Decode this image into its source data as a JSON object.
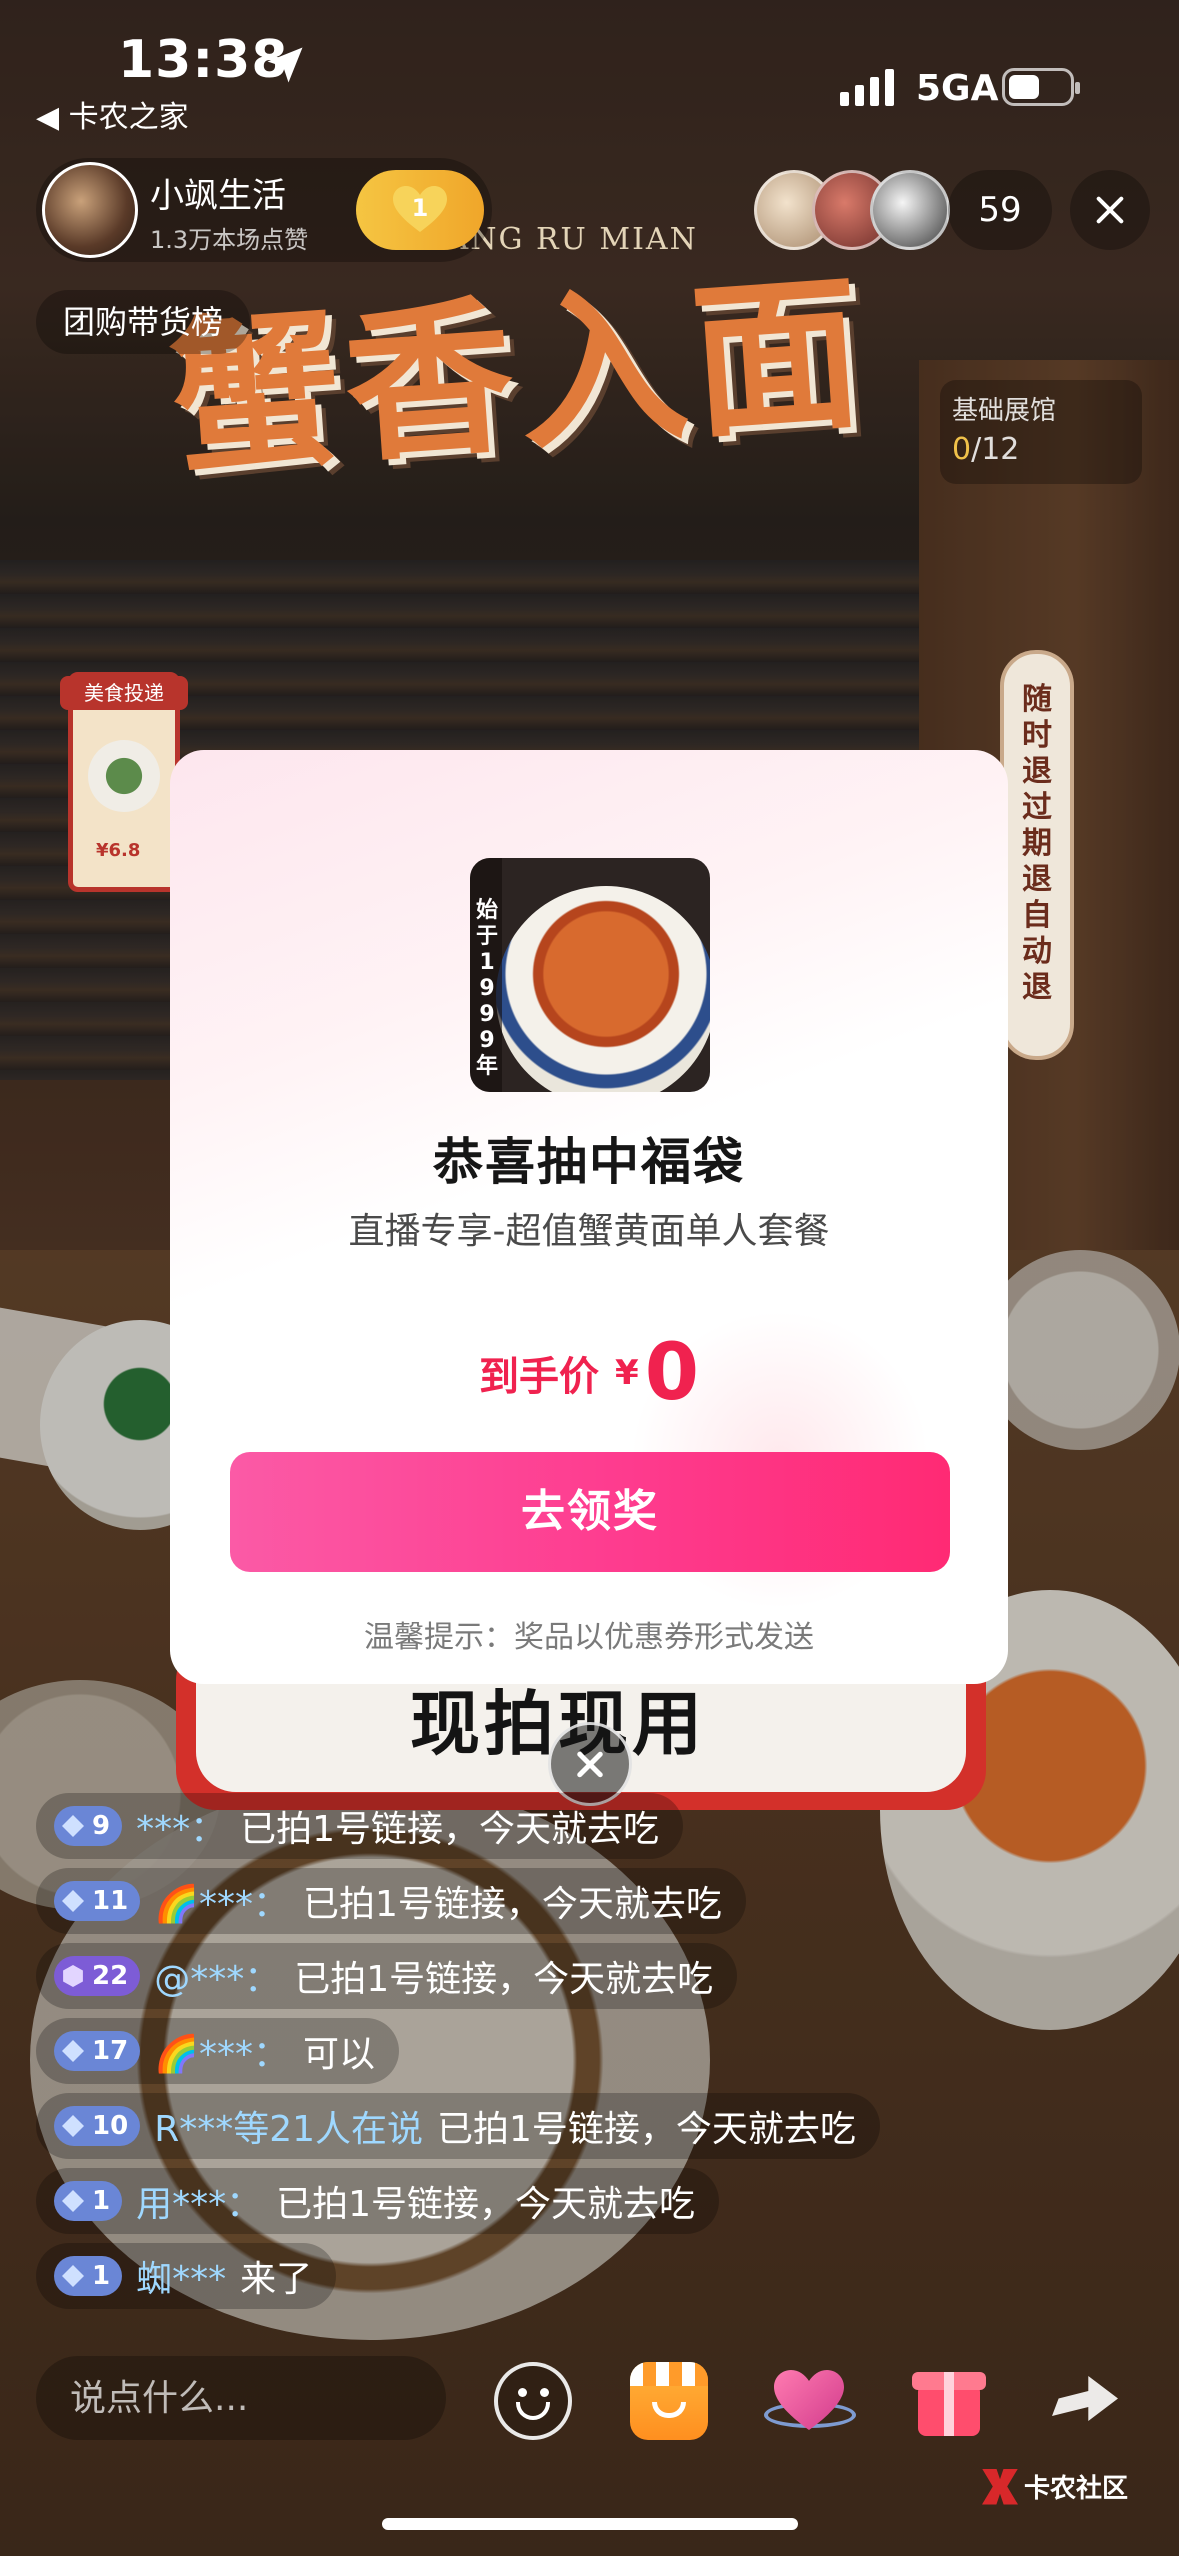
{
  "status_bar": {
    "time": "13:38",
    "back_app": "◀ 卡农之家",
    "network": "5GA"
  },
  "host": {
    "name": "小飒生活",
    "likes": "1.3万本场点赞",
    "follow_level": "1"
  },
  "viewers": {
    "count": "59"
  },
  "rank_label": "团购带货榜",
  "hall": {
    "label": "基础展馆",
    "current": "0",
    "total": "/12"
  },
  "scene": {
    "banner_subtitle": "HUANG RU MIAN",
    "banner_title": "蟹香入面",
    "sticker_title": "美食投递",
    "sticker_price": "¥6.8",
    "side_sign": "随时退 过期退 自动退",
    "promo_text": "现拍现用"
  },
  "modal": {
    "image_text": "始于1999年",
    "title": "恭喜抽中福袋",
    "subtitle": "直播专享-超值蟹黄面单人套餐",
    "price_label": "到手价",
    "price_currency": "¥",
    "price_value": "0",
    "claim_button": "去领奖",
    "tip": "温馨提示：奖品以优惠券形式发送"
  },
  "chat": [
    {
      "level": "9",
      "user": "***：",
      "text": "已拍1号链接，今天就去吃",
      "badge": "blue"
    },
    {
      "level": "11",
      "user": "🌈***：",
      "text": "已拍1号链接，今天就去吃",
      "badge": "blue"
    },
    {
      "level": "22",
      "user": "@***：",
      "text": "已拍1号链接，今天就去吃",
      "badge": "purple"
    },
    {
      "level": "17",
      "user": "🌈***：",
      "text": "可以",
      "badge": "blue"
    },
    {
      "level": "10",
      "user": "R***等21人在说",
      "text": "已拍1号链接，今天就去吃",
      "badge": "blue"
    },
    {
      "level": "1",
      "user": "用***：",
      "text": "已拍1号链接，今天就去吃",
      "badge": "blue"
    },
    {
      "level": "1",
      "user": "蜘***",
      "text": "来了",
      "badge": "blue"
    }
  ],
  "bottom_bar": {
    "input_placeholder": "说点什么..."
  },
  "watermark": "卡农社区",
  "colors": {
    "accent_pink": "#fe3b8e",
    "price_red": "#f0224f",
    "follow_gold": "#f5c542"
  }
}
